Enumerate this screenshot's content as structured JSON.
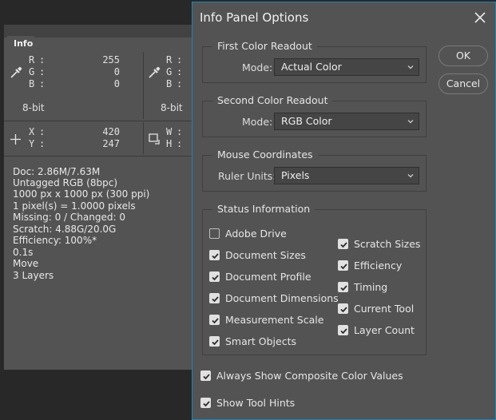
{
  "info_panel": {
    "tab_label": "Info",
    "readout1": {
      "labels": [
        "R",
        "G",
        "B"
      ],
      "values": [
        "255",
        "0",
        "0"
      ],
      "bit_depth": "8-bit"
    },
    "readout2": {
      "labels": [
        "R",
        "G",
        "B"
      ],
      "bit_depth": "8-bit"
    },
    "coords": {
      "x_label": "X",
      "y_label": "Y",
      "x_value": "420",
      "y_value": "247",
      "w_label": "W",
      "h_label": "H"
    },
    "colon": ":",
    "status_lines": [
      "Doc: 2.86M/7.63M",
      "Untagged RGB (8bpc)",
      "1000 px x 1000 px (300 ppi)",
      "1 pixel(s) = 1.0000 pixels",
      "Missing: 0 / Changed: 0",
      "Scratch: 4.88G/20.0G",
      "Efficiency: 100%*",
      "0.1s",
      "Move",
      "3 Layers"
    ]
  },
  "dialog": {
    "title": "Info Panel Options",
    "first_readout": {
      "title": "First Color Readout",
      "mode_label": "Mode:",
      "mode_value": "Actual Color"
    },
    "second_readout": {
      "title": "Second Color Readout",
      "mode_label": "Mode:",
      "mode_value": "RGB Color"
    },
    "mouse": {
      "title": "Mouse Coordinates",
      "units_label": "Ruler Units:",
      "units_value": "Pixels"
    },
    "status": {
      "title": "Status Information",
      "left": [
        {
          "label": "Adobe Drive",
          "checked": false
        },
        {
          "label": "Document Sizes",
          "checked": true
        },
        {
          "label": "Document Profile",
          "checked": true
        },
        {
          "label": "Document Dimensions",
          "checked": true
        },
        {
          "label": "Measurement Scale",
          "checked": true
        },
        {
          "label": "Smart Objects",
          "checked": true
        }
      ],
      "right": [
        {
          "label": "Scratch Sizes",
          "checked": true
        },
        {
          "label": "Efficiency",
          "checked": true
        },
        {
          "label": "Timing",
          "checked": true
        },
        {
          "label": "Current Tool",
          "checked": true
        },
        {
          "label": "Layer Count",
          "checked": true
        }
      ]
    },
    "always_show": {
      "label": "Always Show Composite Color Values",
      "checked": true
    },
    "tool_hints": {
      "label": "Show Tool Hints",
      "checked": true
    },
    "ok_label": "OK",
    "cancel_label": "Cancel"
  },
  "colors": {
    "accent": "#1c85b6",
    "panel_bg": "#535353",
    "app_bg": "#282828"
  }
}
